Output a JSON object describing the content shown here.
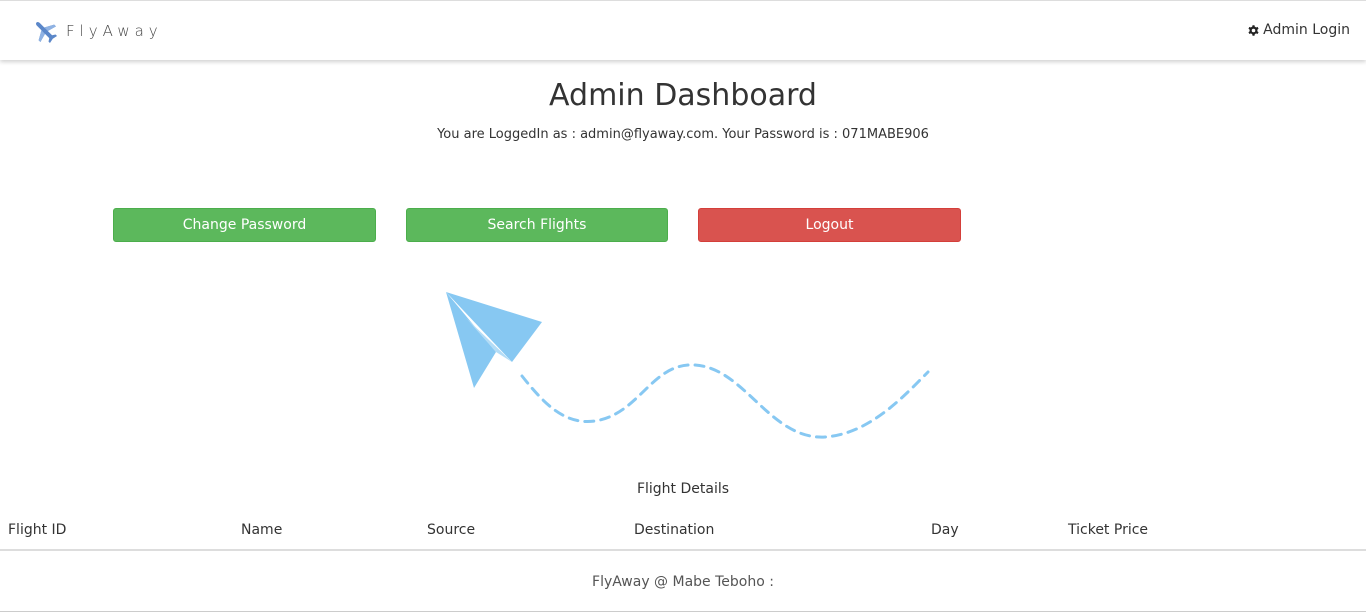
{
  "navbar": {
    "brand": "FlyAway",
    "admin_login": "Admin Login",
    "brand_icon": "airplane-icon",
    "admin_icon": "gear-icon"
  },
  "main": {
    "title": "Admin Dashboard",
    "login_info": "You are LoggedIn as : admin@flyaway.com. Your Password is : 071MABE906"
  },
  "actions": {
    "change_password": "Change Password",
    "search_flights": "Search Flights",
    "logout": "Logout"
  },
  "illustration": {
    "icon": "paper-plane-icon",
    "color": "#87c8f2"
  },
  "flight_table": {
    "caption": "Flight Details",
    "columns": [
      "Flight ID",
      "Name",
      "Source",
      "Destination",
      "Day",
      "Ticket Price"
    ]
  },
  "footer": {
    "text": "FlyAway @ Mabe Teboho :"
  },
  "colors": {
    "success": "#5cb85c",
    "danger": "#d9534f"
  }
}
